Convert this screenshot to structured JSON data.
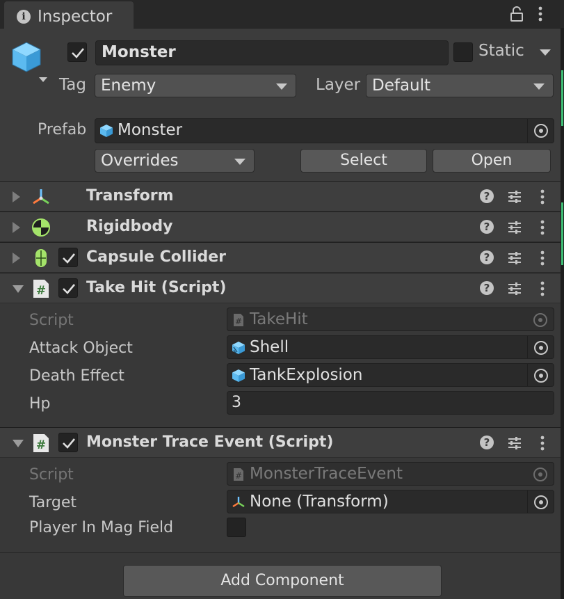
{
  "tab": {
    "title": "Inspector",
    "info_icon": "i"
  },
  "header": {
    "active": true,
    "name": "Monster",
    "static_label": "Static",
    "static": false,
    "tag_label": "Tag",
    "tag_value": "Enemy",
    "layer_label": "Layer",
    "layer_value": "Default",
    "prefab_label": "Prefab",
    "prefab_value": "Monster",
    "overrides_value": "Overrides",
    "select_label": "Select",
    "open_label": "Open"
  },
  "components": {
    "transform": {
      "title": "Transform",
      "expanded": false
    },
    "rigidbody": {
      "title": "Rigidbody",
      "expanded": false
    },
    "capsule": {
      "title": "Capsule Collider",
      "enabled": true,
      "expanded": false
    },
    "takehit": {
      "title": "Take Hit (Script)",
      "enabled": true,
      "expanded": true,
      "script_label": "Script",
      "script_value": "TakeHit",
      "attack_label": "Attack Object",
      "attack_value": "Shell",
      "death_label": "Death Effect",
      "death_value": "TankExplosion",
      "hp_label": "Hp",
      "hp_value": "3"
    },
    "trace": {
      "title": "Monster Trace Event (Script)",
      "enabled": true,
      "expanded": true,
      "script_label": "Script",
      "script_value": "MonsterTraceEvent",
      "target_label": "Target",
      "target_value": "None (Transform)",
      "player_label": "Player In Mag Field",
      "player_value": false
    }
  },
  "help_glyph": "?",
  "footer": {
    "add_component": "Add Component"
  },
  "colors": {
    "panel": "#383838",
    "header": "#3c3c3c",
    "field": "#2a2a2a",
    "prefab_blue": "#6ac3f0",
    "accent_green": "#3fbf76"
  }
}
